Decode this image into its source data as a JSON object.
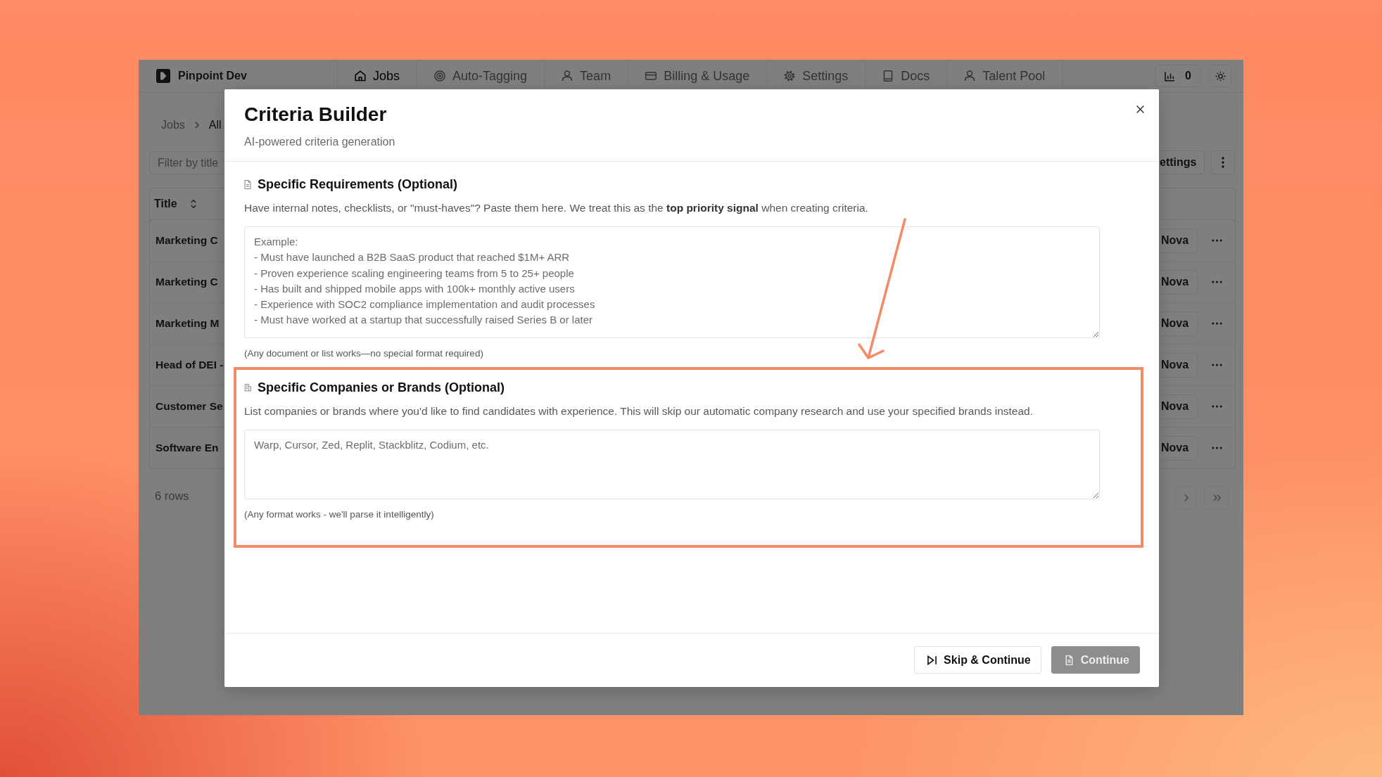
{
  "app": {
    "name": "Pinpoint Dev"
  },
  "nav": {
    "tabs": [
      {
        "label": "Jobs",
        "selected": true
      },
      {
        "label": "Auto-Tagging",
        "selected": false
      },
      {
        "label": "Team",
        "selected": false
      },
      {
        "label": "Billing & Usage",
        "selected": false
      },
      {
        "label": "Settings",
        "selected": false
      },
      {
        "label": "Docs",
        "selected": false
      },
      {
        "label": "Talent Pool",
        "selected": false
      }
    ],
    "usage_count": "0"
  },
  "jobs_page": {
    "breadcrumb": [
      "Jobs",
      "All"
    ],
    "filter": {
      "placeholder": "Filter by title"
    },
    "settings_button": "ettings",
    "table": {
      "columns": [
        "Title"
      ],
      "rows": [
        {
          "title": "Marketing C",
          "tag": "Nova"
        },
        {
          "title": "Marketing C",
          "tag": "Nova"
        },
        {
          "title": "Marketing M",
          "tag": "Nova"
        },
        {
          "title": "Head of DEI -",
          "tag": "Nova"
        },
        {
          "title": "Customer Se",
          "tag": "Nova"
        },
        {
          "title": "Software En",
          "tag": "Nova"
        }
      ]
    },
    "row_count": "6 rows"
  },
  "modal": {
    "title": "Criteria Builder",
    "subtitle": "AI-powered criteria generation",
    "sections": [
      {
        "kind": "notes",
        "heading": "Specific Requirements (Optional)",
        "description": "Have internal notes, checklists, or \"must-haves\"? Paste them here. We treat this as the **top priority signal** when creating criteria.",
        "placeholder": "Example:\n- Must have launched a B2B SaaS product that reached $1M+ ARR\n- Proven experience scaling engineering teams from 5 to 25+ people\n- Has built and shipped mobile apps with 100k+ monthly active users\n- Experience with SOC2 compliance implementation and audit processes\n- Must have worked at a startup that successfully raised Series B or later",
        "hint": "(Any document or list works—no special format required)",
        "highlighted": false
      },
      {
        "kind": "brands",
        "heading": "Specific Companies or Brands (Optional)",
        "description": "List companies or brands where you'd like to find candidates with experience. This will skip our automatic company research and use your specified brands instead.",
        "placeholder": "Warp, Cursor, Zed, Replit, Stackblitz, Codium, etc.",
        "hint": "(Any format works - we'll parse it intelligently)",
        "highlighted": true
      }
    ],
    "buttons": [
      {
        "kind": "secondary",
        "label": "Skip & Continue",
        "disabled": false
      },
      {
        "kind": "primary",
        "label": "Continue",
        "disabled": true
      }
    ]
  }
}
